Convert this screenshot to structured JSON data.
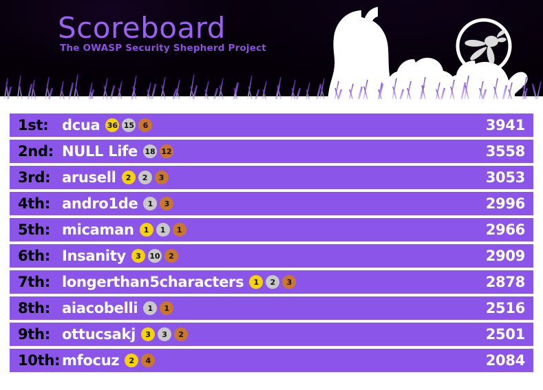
{
  "banner": {
    "title": "Scoreboard",
    "subtitle": "The OWASP Security Shepherd Project",
    "title_color": "#9a63ee",
    "subtitle_color": "#8a52dd",
    "background_color": "#050008",
    "artwork": [
      "shepherd-silhouette",
      "sheep-silhouette",
      "sheep-silhouette",
      "owasp-wasp-logo",
      "grass-silhouette"
    ]
  },
  "scoreboard": {
    "row_color": "#8c55ea",
    "medal_colors": {
      "gold": "#f5d20c",
      "silver": "#c8c8c8",
      "bronze": "#c8772c"
    },
    "rows": [
      {
        "rank": "1st:",
        "player": "dcua",
        "gold": "36",
        "silver": "15",
        "bronze": "6",
        "score": "3941"
      },
      {
        "rank": "2nd:",
        "player": "NULL Life",
        "gold": "",
        "silver": "18",
        "bronze": "12",
        "score": "3558"
      },
      {
        "rank": "3rd:",
        "player": "arusell",
        "gold": "2",
        "silver": "2",
        "bronze": "3",
        "score": "3053"
      },
      {
        "rank": "4th:",
        "player": "andro1de",
        "gold": "",
        "silver": "1",
        "bronze": "3",
        "score": "2996"
      },
      {
        "rank": "5th:",
        "player": "micaman",
        "gold": "1",
        "silver": "1",
        "bronze": "1",
        "score": "2966"
      },
      {
        "rank": "6th:",
        "player": "Insanity",
        "gold": "3",
        "silver": "10",
        "bronze": "2",
        "score": "2909"
      },
      {
        "rank": "7th:",
        "player": "longerthan5characters",
        "gold": "1",
        "silver": "2",
        "bronze": "3",
        "score": "2878"
      },
      {
        "rank": "8th:",
        "player": "aiacobelli",
        "gold": "",
        "silver": "1",
        "bronze": "1",
        "score": "2516"
      },
      {
        "rank": "9th:",
        "player": "ottucsakj",
        "gold": "3",
        "silver": "3",
        "bronze": "2",
        "score": "2501"
      },
      {
        "rank": "10th:",
        "player": "mfocuz",
        "gold": "2",
        "silver": "",
        "bronze": "4",
        "score": "2084"
      }
    ]
  }
}
